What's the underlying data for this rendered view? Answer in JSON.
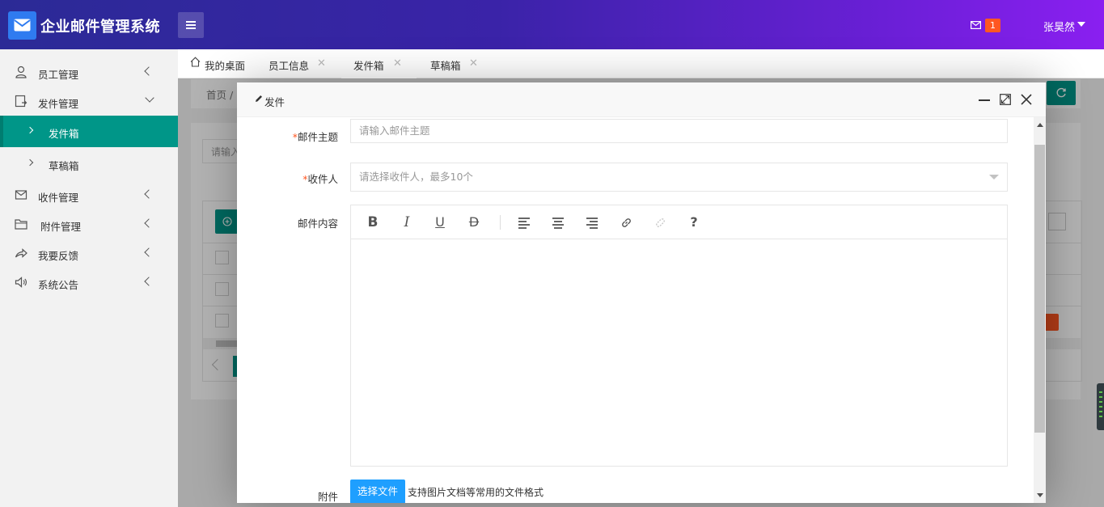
{
  "app": {
    "title": "企业邮件管理系统"
  },
  "header": {
    "mail_count": "1",
    "user_name": "张昊然"
  },
  "sidebar": {
    "items": [
      {
        "label": "员工管理",
        "icon": "user-icon"
      },
      {
        "label": "发件管理",
        "icon": "send-box-icon"
      },
      {
        "label": "收件管理",
        "icon": "mail-icon"
      },
      {
        "label": "附件管理",
        "icon": "folder-icon"
      },
      {
        "label": "我要反馈",
        "icon": "share-icon"
      },
      {
        "label": "系统公告",
        "icon": "speaker-icon"
      }
    ],
    "sub_items": [
      {
        "label": "发件箱",
        "active": true
      },
      {
        "label": "草稿箱",
        "active": false
      }
    ]
  },
  "tabs": [
    {
      "label": "我的桌面",
      "icon": "home-icon"
    },
    {
      "label": "员工信息"
    },
    {
      "label": "发件箱",
      "active": true
    },
    {
      "label": "草稿箱"
    }
  ],
  "background_page": {
    "breadcrumb": "首页 /",
    "search_placeholder": "请输入"
  },
  "modal": {
    "title": "发件",
    "subject_label": "邮件主题",
    "subject_placeholder": "请输入邮件主题",
    "recipient_label": "收件人",
    "recipient_placeholder": "请选择收件人，最多10个",
    "content_label": "邮件内容",
    "attachment_label": "附件",
    "upload_button": "选择文件",
    "upload_tip": "支持图片文档等常用的文件格式",
    "required_mark": "*",
    "toolbar": [
      "bold",
      "italic",
      "underline",
      "strikethrough",
      "align-left",
      "align-center",
      "align-right",
      "link",
      "unlink",
      "help"
    ]
  },
  "colors": {
    "header_start": "#2b2a96",
    "header_end": "#8a1ff0",
    "active_green": "#009688",
    "badge": "#ff5722",
    "upload_blue": "#1e9fff"
  }
}
